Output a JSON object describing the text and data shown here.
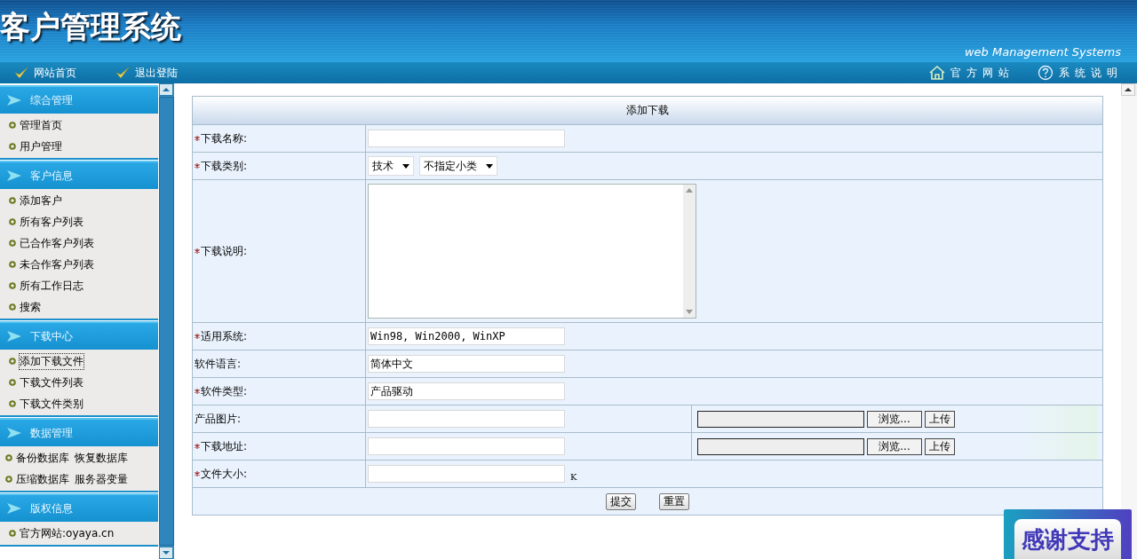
{
  "header": {
    "title": "客户管理系统",
    "subtitle": "web Management Systems"
  },
  "nav_left": [
    {
      "label": "网站首页"
    },
    {
      "label": "退出登陆"
    }
  ],
  "nav_right": [
    {
      "kind": "home",
      "label": "官方网站"
    },
    {
      "kind": "help",
      "label": "系统说明"
    }
  ],
  "sidebar": [
    {
      "title": "综合管理",
      "kind": "list",
      "items": [
        {
          "label": "管理首页",
          "selected": false
        },
        {
          "label": "用户管理",
          "selected": false
        }
      ]
    },
    {
      "title": "客户信息",
      "kind": "list",
      "items": [
        {
          "label": "添加客户",
          "selected": false
        },
        {
          "label": "所有客户列表",
          "selected": false
        },
        {
          "label": "已合作客户列表",
          "selected": false
        },
        {
          "label": "未合作客户列表",
          "selected": false
        },
        {
          "label": "所有工作日志",
          "selected": false
        },
        {
          "label": "搜索",
          "selected": false
        }
      ]
    },
    {
      "title": "下载中心",
      "kind": "list",
      "items": [
        {
          "label": "添加下载文件",
          "selected": true
        },
        {
          "label": "下载文件列表",
          "selected": false
        },
        {
          "label": "下载文件类别",
          "selected": false
        }
      ]
    },
    {
      "title": "数据管理",
      "kind": "grid",
      "items": [
        {
          "label": "备份数据库",
          "selected": false
        },
        {
          "label": "恢复数据库",
          "selected": false
        },
        {
          "label": "压缩数据库",
          "selected": false
        },
        {
          "label": "服务器变量",
          "selected": false
        }
      ]
    },
    {
      "title": "版权信息",
      "kind": "list",
      "items": [
        {
          "label": "官方网站:oyaya.cn",
          "selected": false
        }
      ]
    }
  ],
  "form": {
    "title": "添加下载",
    "rows": [
      {
        "kind": "text",
        "label": "下载名称:",
        "required": true,
        "value": ""
      },
      {
        "kind": "selects",
        "label": "下载类别:",
        "required": true,
        "selects": [
          "技术",
          "不指定小类"
        ]
      },
      {
        "kind": "textarea",
        "label": "下载说明:",
        "required": true,
        "value": ""
      },
      {
        "kind": "text",
        "label": "适用系统:",
        "required": true,
        "value": "Win98, Win2000, WinXP"
      },
      {
        "kind": "text",
        "label": "软件语言:",
        "required": false,
        "value": "简体中文"
      },
      {
        "kind": "text",
        "label": "软件类型:",
        "required": true,
        "value": "产品驱动"
      },
      {
        "kind": "upload",
        "label": "产品图片:",
        "required": false,
        "value": "",
        "browse": "浏览...",
        "upload": "上传"
      },
      {
        "kind": "upload",
        "label": "下载地址:",
        "required": true,
        "value": "",
        "browse": "浏览...",
        "upload": "上传"
      },
      {
        "kind": "size",
        "label": "文件大小:",
        "required": true,
        "value": "",
        "unit": "K"
      }
    ],
    "buttons": [
      "提交",
      "重置"
    ]
  },
  "badge": "感谢支持"
}
